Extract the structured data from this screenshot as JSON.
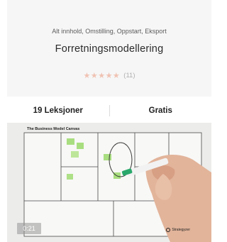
{
  "course": {
    "categories": "Alt innhold, Omstilling, Oppstart, Eksport",
    "title": "Forretningsmodellering",
    "rating": {
      "stars": 5,
      "stars_display": "★★★★★",
      "count": "(11)"
    },
    "lessons": "19 Leksjoner",
    "price": "Gratis"
  },
  "thumbnail": {
    "canvas_title": "The Business Model Canvas",
    "duration": "0:21",
    "brand": "Strategyzer"
  },
  "colors": {
    "star": "#f0c2b2",
    "card_background": "#f6f6f6",
    "sticky_note": "#9bd96b",
    "marker": "#2aa86b"
  }
}
